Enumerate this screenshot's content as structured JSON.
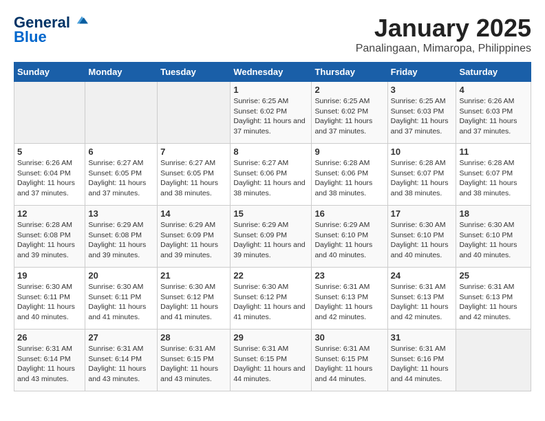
{
  "header": {
    "logo_line1": "General",
    "logo_line2": "Blue",
    "title": "January 2025",
    "subtitle": "Panalingaan, Mimaropa, Philippines"
  },
  "calendar": {
    "days_of_week": [
      "Sunday",
      "Monday",
      "Tuesday",
      "Wednesday",
      "Thursday",
      "Friday",
      "Saturday"
    ],
    "weeks": [
      [
        {
          "day": "",
          "info": ""
        },
        {
          "day": "",
          "info": ""
        },
        {
          "day": "",
          "info": ""
        },
        {
          "day": "1",
          "sunrise": "6:25 AM",
          "sunset": "6:02 PM",
          "daylight": "11 hours and 37 minutes."
        },
        {
          "day": "2",
          "sunrise": "6:25 AM",
          "sunset": "6:02 PM",
          "daylight": "11 hours and 37 minutes."
        },
        {
          "day": "3",
          "sunrise": "6:25 AM",
          "sunset": "6:03 PM",
          "daylight": "11 hours and 37 minutes."
        },
        {
          "day": "4",
          "sunrise": "6:26 AM",
          "sunset": "6:03 PM",
          "daylight": "11 hours and 37 minutes."
        }
      ],
      [
        {
          "day": "5",
          "sunrise": "6:26 AM",
          "sunset": "6:04 PM",
          "daylight": "11 hours and 37 minutes."
        },
        {
          "day": "6",
          "sunrise": "6:27 AM",
          "sunset": "6:05 PM",
          "daylight": "11 hours and 37 minutes."
        },
        {
          "day": "7",
          "sunrise": "6:27 AM",
          "sunset": "6:05 PM",
          "daylight": "11 hours and 38 minutes."
        },
        {
          "day": "8",
          "sunrise": "6:27 AM",
          "sunset": "6:06 PM",
          "daylight": "11 hours and 38 minutes."
        },
        {
          "day": "9",
          "sunrise": "6:28 AM",
          "sunset": "6:06 PM",
          "daylight": "11 hours and 38 minutes."
        },
        {
          "day": "10",
          "sunrise": "6:28 AM",
          "sunset": "6:07 PM",
          "daylight": "11 hours and 38 minutes."
        },
        {
          "day": "11",
          "sunrise": "6:28 AM",
          "sunset": "6:07 PM",
          "daylight": "11 hours and 38 minutes."
        }
      ],
      [
        {
          "day": "12",
          "sunrise": "6:28 AM",
          "sunset": "6:08 PM",
          "daylight": "11 hours and 39 minutes."
        },
        {
          "day": "13",
          "sunrise": "6:29 AM",
          "sunset": "6:08 PM",
          "daylight": "11 hours and 39 minutes."
        },
        {
          "day": "14",
          "sunrise": "6:29 AM",
          "sunset": "6:09 PM",
          "daylight": "11 hours and 39 minutes."
        },
        {
          "day": "15",
          "sunrise": "6:29 AM",
          "sunset": "6:09 PM",
          "daylight": "11 hours and 39 minutes."
        },
        {
          "day": "16",
          "sunrise": "6:29 AM",
          "sunset": "6:10 PM",
          "daylight": "11 hours and 40 minutes."
        },
        {
          "day": "17",
          "sunrise": "6:30 AM",
          "sunset": "6:10 PM",
          "daylight": "11 hours and 40 minutes."
        },
        {
          "day": "18",
          "sunrise": "6:30 AM",
          "sunset": "6:10 PM",
          "daylight": "11 hours and 40 minutes."
        }
      ],
      [
        {
          "day": "19",
          "sunrise": "6:30 AM",
          "sunset": "6:11 PM",
          "daylight": "11 hours and 40 minutes."
        },
        {
          "day": "20",
          "sunrise": "6:30 AM",
          "sunset": "6:11 PM",
          "daylight": "11 hours and 41 minutes."
        },
        {
          "day": "21",
          "sunrise": "6:30 AM",
          "sunset": "6:12 PM",
          "daylight": "11 hours and 41 minutes."
        },
        {
          "day": "22",
          "sunrise": "6:30 AM",
          "sunset": "6:12 PM",
          "daylight": "11 hours and 41 minutes."
        },
        {
          "day": "23",
          "sunrise": "6:31 AM",
          "sunset": "6:13 PM",
          "daylight": "11 hours and 42 minutes."
        },
        {
          "day": "24",
          "sunrise": "6:31 AM",
          "sunset": "6:13 PM",
          "daylight": "11 hours and 42 minutes."
        },
        {
          "day": "25",
          "sunrise": "6:31 AM",
          "sunset": "6:13 PM",
          "daylight": "11 hours and 42 minutes."
        }
      ],
      [
        {
          "day": "26",
          "sunrise": "6:31 AM",
          "sunset": "6:14 PM",
          "daylight": "11 hours and 43 minutes."
        },
        {
          "day": "27",
          "sunrise": "6:31 AM",
          "sunset": "6:14 PM",
          "daylight": "11 hours and 43 minutes."
        },
        {
          "day": "28",
          "sunrise": "6:31 AM",
          "sunset": "6:15 PM",
          "daylight": "11 hours and 43 minutes."
        },
        {
          "day": "29",
          "sunrise": "6:31 AM",
          "sunset": "6:15 PM",
          "daylight": "11 hours and 44 minutes."
        },
        {
          "day": "30",
          "sunrise": "6:31 AM",
          "sunset": "6:15 PM",
          "daylight": "11 hours and 44 minutes."
        },
        {
          "day": "31",
          "sunrise": "6:31 AM",
          "sunset": "6:16 PM",
          "daylight": "11 hours and 44 minutes."
        },
        {
          "day": "",
          "info": ""
        }
      ]
    ]
  }
}
